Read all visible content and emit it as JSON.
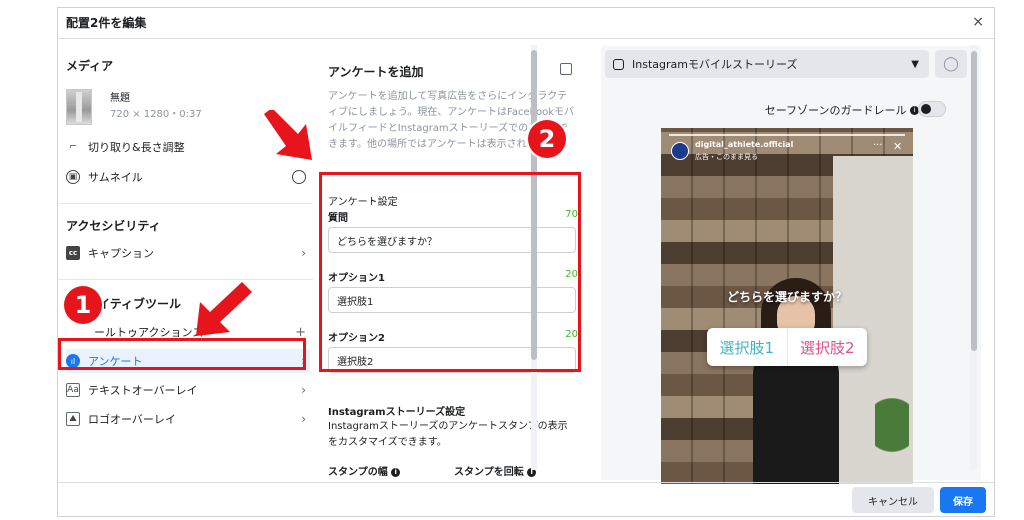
{
  "modal": {
    "title": "配置2件を編集",
    "close": "×"
  },
  "left": {
    "media_heading": "メディア",
    "media_name": "無題",
    "media_meta": "720 × 1280・0:37",
    "crop_label": "切り取り&長さ調整",
    "thumbnail_label": "サムネイル",
    "accessibility_heading": "アクセシビリティ",
    "caption_label": "キャプション",
    "creative_heading": "クリエイティブツール",
    "creative_heading_visible": "イティブツール",
    "cta_label": "コールトゥアクションステッカー",
    "cta_label_visible": "ールトゥアクションス",
    "poll_label": "アンケート",
    "text_overlay_label": "テキストオーバーレイ",
    "logo_overlay_label": "ロゴオーバーレイ"
  },
  "middle": {
    "title": "アンケートを追加",
    "description": "アンケートを追加して写真広告をさらにインタラクティブにしましょう。現在、アンケートはFacebookモバイルフィードとInstagramストーリーズでのみ利用できます。他の場所ではアンケートは表示されません。",
    "settings_label": "アンケート設定",
    "question_label": "質問",
    "question_count": "70",
    "question_value": "どちらを選びますか？",
    "option1_label": "オプション1",
    "option1_count": "20",
    "option1_value": "選択肢1",
    "option2_label": "オプション2",
    "option2_count": "20",
    "option2_value": "選択肢2",
    "ig_settings_title": "Instagramストーリーズ設定",
    "ig_settings_desc": "Instagramストーリーズのアンケートスタンプの表示をカスタマイズできます。",
    "sticker_width_label": "スタンプの幅",
    "sticker_rotate_label": "スタンプを回転"
  },
  "preview": {
    "placement": "Instagramモバイルストーリーズ",
    "safe_zone_label": "セーフゾーンのガードレール",
    "story_user": "digital_athlete.official",
    "story_sub": "広告・このまま見る",
    "poll_question": "どちらを選びますか？",
    "poll_option1": "選択肢1",
    "poll_option2": "選択肢2"
  },
  "footer": {
    "cancel": "キャンセル",
    "save": "保存"
  },
  "annotations": {
    "badge1": "1",
    "badge2": "2"
  },
  "colors": {
    "accent": "#1877f2",
    "highlight": "#e8141c",
    "count": "#42b72a"
  }
}
